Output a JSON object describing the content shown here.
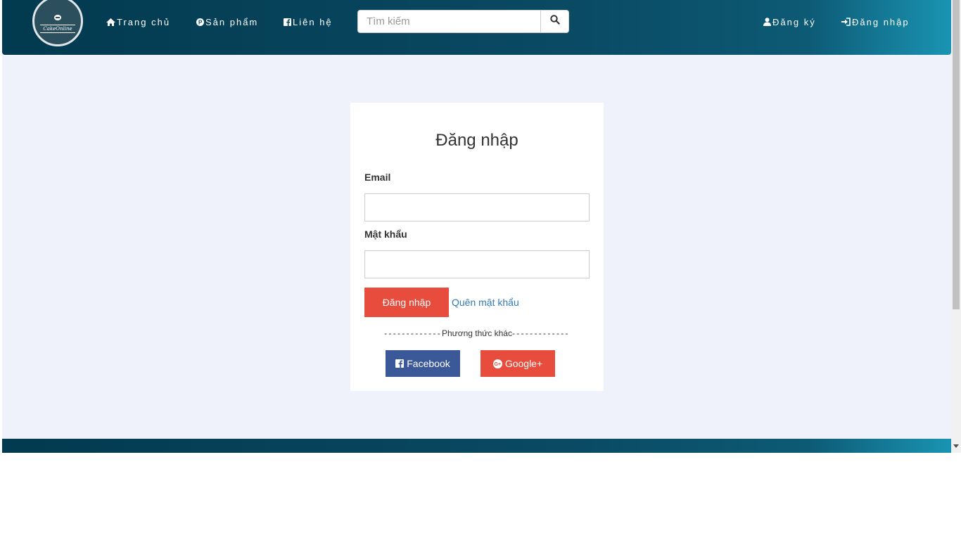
{
  "nav": {
    "logo_text": "CakeOnline",
    "items": [
      {
        "label": "Trang chủ",
        "icon": "home-icon"
      },
      {
        "label": "Sản phẩm",
        "icon": "product-icon"
      },
      {
        "label": "Liên hệ",
        "icon": "facebook-icon"
      }
    ],
    "search": {
      "placeholder": "Tìm kiếm",
      "value": "",
      "icon": "search-icon"
    },
    "right_items": [
      {
        "label": "Đăng ký",
        "icon": "user-icon"
      },
      {
        "label": "Đăng nhập",
        "icon": "sign-in-icon"
      }
    ]
  },
  "login": {
    "title": "Đăng nhập",
    "email_label": "Email",
    "email_value": "",
    "password_label": "Mật khẩu",
    "password_value": "",
    "submit_label": "Đăng nhập",
    "forgot_label": "Quên mật khẩu",
    "divider_text": "Phương thức khác",
    "facebook_label": "Facebook",
    "google_label": "Google+"
  },
  "colors": {
    "nav_gradient_start": "#023a4f",
    "nav_gradient_end": "#1a94b3",
    "page_bg": "#eff2fb",
    "primary_red": "#e74c3c",
    "facebook_blue": "#3b5998",
    "link_blue": "#337ab7"
  }
}
